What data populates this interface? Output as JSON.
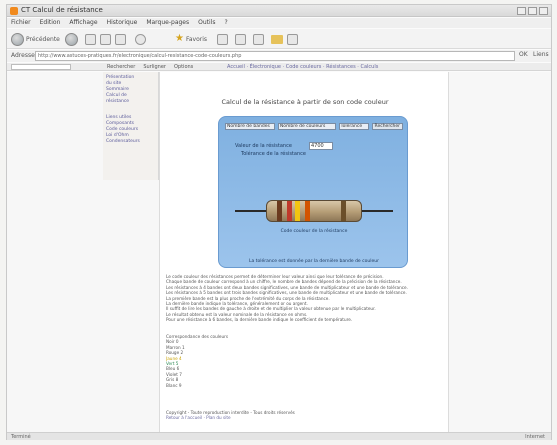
{
  "window": {
    "title": "CT Calcul de résistance"
  },
  "menu": [
    "Fichier",
    "Edition",
    "Affichage",
    "Historique",
    "Marque-pages",
    "Outils",
    "?"
  ],
  "nav": {
    "back": "Précédente",
    "favorites": "Favoris",
    "history": "Historique"
  },
  "address": {
    "label": "Adresse",
    "url": "http://www.astuces-pratiques.fr/electronique/calcul-resistance-code-couleurs.php",
    "go": "OK",
    "links": "Liens"
  },
  "tabs": [
    "Rechercher",
    "Surligner",
    "Options"
  ],
  "tab_links": "Accueil · Électronique · Code couleurs · Résistances · Calculs",
  "leftmenu": [
    [
      "Présentation",
      "du site",
      "Sommaire",
      "Calcul de",
      "résistance"
    ],
    [
      "Liens utiles",
      "Composants",
      "Code couleurs",
      "Loi d'Ohm",
      "Condensateurs"
    ]
  ],
  "page": {
    "title": "Calcul de la résistance à partir de son code couleur",
    "panel": {
      "selects": [
        "Nombre de bandes",
        "Nombre de couleurs",
        "Tolérance"
      ],
      "button": "Rechercher",
      "label1": "Valeur de la résistance",
      "label2": "Tolérance de la résistance",
      "field1": "4700",
      "caption_resistor": "Code couleur de la résistance",
      "caption_bottom": "La tolérance est donnée par la dernière bande de couleur"
    },
    "text_lines": [
      "Le code couleur des résistances permet de déterminer leur valeur ainsi que leur tolérance de précision.",
      "Chaque bande de couleur correspond à un chiffre, le nombre de bandes dépend de la précision de la résistance.",
      "Les résistances à 4 bandes ont deux bandes significatives, une bande de multiplicateur et une bande de tolérance.",
      "Les résistances à 5 bandes ont trois bandes significatives, une bande de multiplicateur et une bande de tolérance.",
      "La première bande est la plus proche de l'extrémité du corps de la résistance.",
      "La dernière bande indique la tolérance, généralement or ou argent.",
      "Il suffit de lire les bandes de gauche à droite et de multiplier la valeur obtenue par le multiplicateur.",
      "Le résultat obtenu est la valeur nominale de la résistance en ohms.",
      "Pour une résistance à 6 bandes, la dernière bande indique le coefficient de température."
    ],
    "colors_title": "Correspondance des couleurs",
    "color_lines": [
      [
        "Noir 0",
        ""
      ],
      [
        "Marron 1",
        ""
      ],
      [
        "Rouge 2",
        ""
      ],
      [
        "Jaune 4",
        "c1"
      ],
      [
        "Vert 5",
        "c2"
      ],
      [
        "Bleu 6",
        ""
      ],
      [
        "Violet 7",
        ""
      ],
      [
        "Gris 8",
        ""
      ],
      [
        "Blanc 9",
        ""
      ]
    ],
    "footer_line": "Copyright - Toute reproduction interdite - Tous droits réservés",
    "bottom_links": "Retour à l'accueil · Plan du site"
  },
  "status": {
    "left": "Terminé",
    "right": "Internet"
  }
}
